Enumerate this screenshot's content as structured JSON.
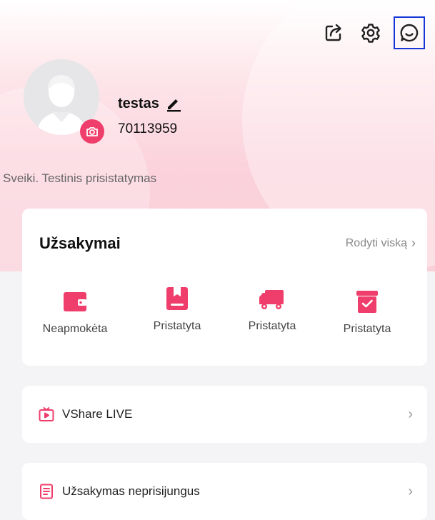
{
  "colors": {
    "accent": "#ef3e6b",
    "highlight_border": "#1535d8"
  },
  "header": {
    "icons": [
      "share-icon",
      "settings-icon",
      "support-chat-icon"
    ]
  },
  "profile": {
    "username": "testas",
    "user_id": "70113959",
    "bio": "Sveiki. Testinis prisistatymas"
  },
  "orders": {
    "title": "Užsakymai",
    "show_all": "Rodyti viską",
    "items": [
      {
        "label": "Neapmokėta",
        "icon": "wallet-icon"
      },
      {
        "label": "Pristatyta",
        "icon": "package-icon"
      },
      {
        "label": "Pristatyta",
        "icon": "truck-icon"
      },
      {
        "label": "Pristatyta",
        "icon": "box-check-icon"
      }
    ]
  },
  "menu": [
    {
      "label": "VShare LIVE",
      "icon": "live-tv-icon"
    },
    {
      "label": "Užsakymas neprisijungus",
      "icon": "document-icon"
    }
  ]
}
